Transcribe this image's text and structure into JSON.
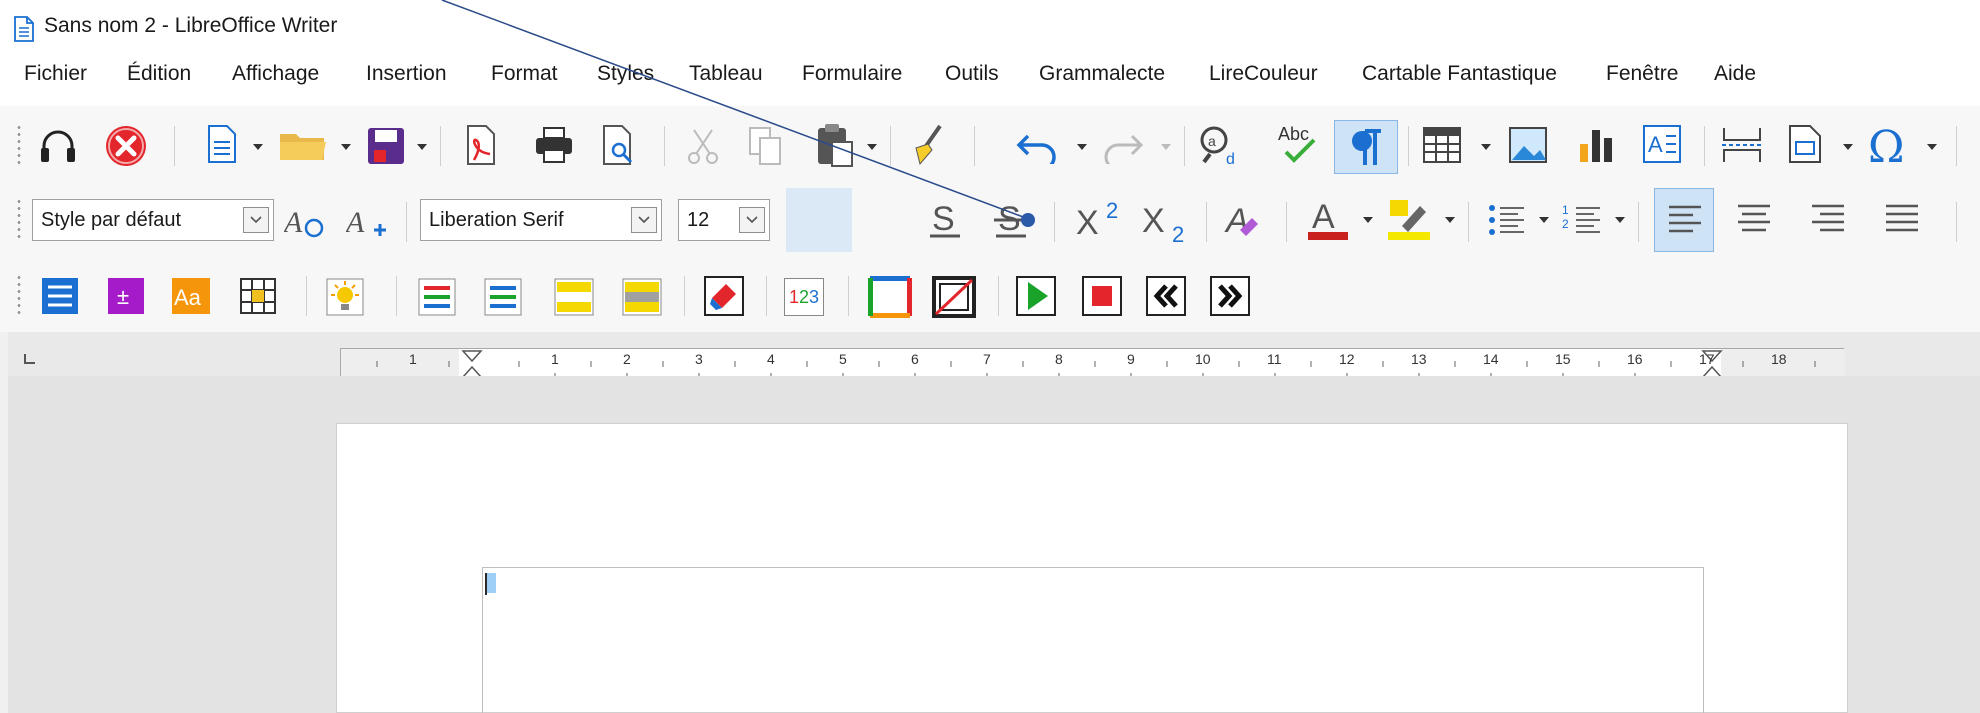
{
  "window": {
    "title": "Sans nom 2 - LibreOffice Writer"
  },
  "menu": [
    "Fichier",
    "Édition",
    "Affichage",
    "Insertion",
    "Format",
    "Styles",
    "Tableau",
    "Formulaire",
    "Outils",
    "Grammalecte",
    "LireCouleur",
    "Cartable Fantastique",
    "Fenêtre",
    "Aide"
  ],
  "formatting": {
    "paragraph_style": "Style par défaut",
    "font_name": "Liberation Serif",
    "font_size": "12"
  },
  "ruler": {
    "labels": [
      "1",
      "1",
      "2",
      "3",
      "4",
      "5",
      "6",
      "7",
      "8",
      "9",
      "10",
      "11",
      "12",
      "13",
      "14",
      "15",
      "16",
      "17",
      "18"
    ],
    "zoom": ""
  },
  "toolbar3": {
    "number_icon_text": "123"
  },
  "colors": {
    "toolbar_bg": "#f7f7f7",
    "accent_blue": "#1a6fd1",
    "active_toggle": "#cfe3f7",
    "red": "#e2262b",
    "green": "#1aa32a",
    "yellow": "#f5d800"
  }
}
